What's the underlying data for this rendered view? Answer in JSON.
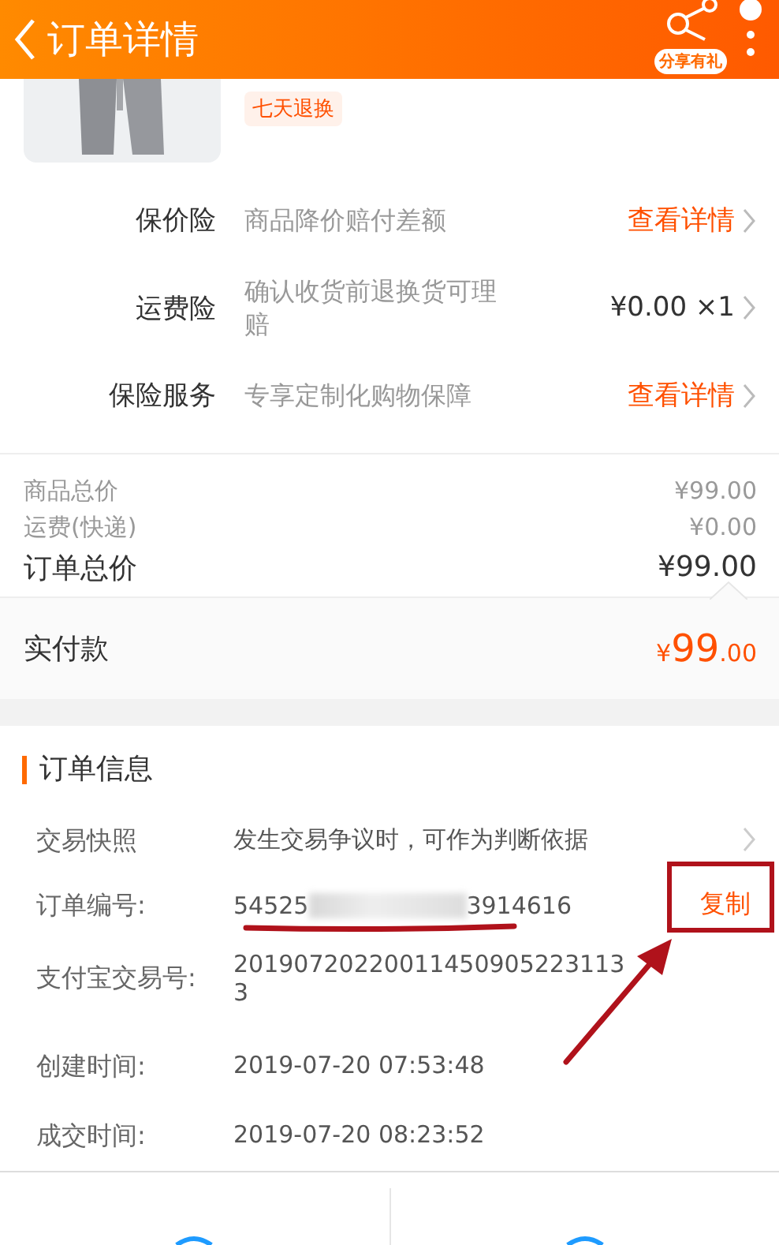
{
  "header": {
    "title": "订单详情",
    "share_badge": "分享有礼"
  },
  "product": {
    "kind": "picture",
    "tag": "七天退换"
  },
  "services": [
    {
      "label": "保价险",
      "desc": "商品降价赔付差额",
      "action": "查看详情",
      "kind": "link"
    },
    {
      "label": "运费险",
      "desc": "确认收货前退换货可理赔",
      "action": "¥0.00 ×1",
      "kind": "price"
    },
    {
      "label": "保险服务",
      "desc": "专享定制化购物保障",
      "action": "查看详情",
      "kind": "link"
    }
  ],
  "price_summary": [
    {
      "label": "商品总价",
      "value": "¥99.00",
      "kind": "minor"
    },
    {
      "label": "运费(快递)",
      "value": "¥0.00",
      "kind": "minor"
    },
    {
      "label": "订单总价",
      "value": "¥99.00",
      "kind": "major"
    }
  ],
  "paid": {
    "label": "实付款",
    "currency": "¥",
    "amount": "99",
    "decimals": ".00"
  },
  "order_info": {
    "title": "订单信息",
    "rows": [
      {
        "kind": "link",
        "label": "交易快照",
        "value": "发生交易争议时，可作为判断依据"
      },
      {
        "kind": "blurred",
        "label": "订单编号:",
        "value_start": "54525",
        "value_end": "3914616",
        "action": "复制"
      },
      {
        "kind": "plain",
        "label": "支付宝交易号:",
        "value": "201907202200114509052231133"
      },
      {
        "kind": "plain",
        "label": "创建时间:",
        "value": "2019-07-20 07:53:48"
      },
      {
        "kind": "plain",
        "label": "成交时间:",
        "value": "2019-07-20 08:23:52"
      }
    ]
  }
}
